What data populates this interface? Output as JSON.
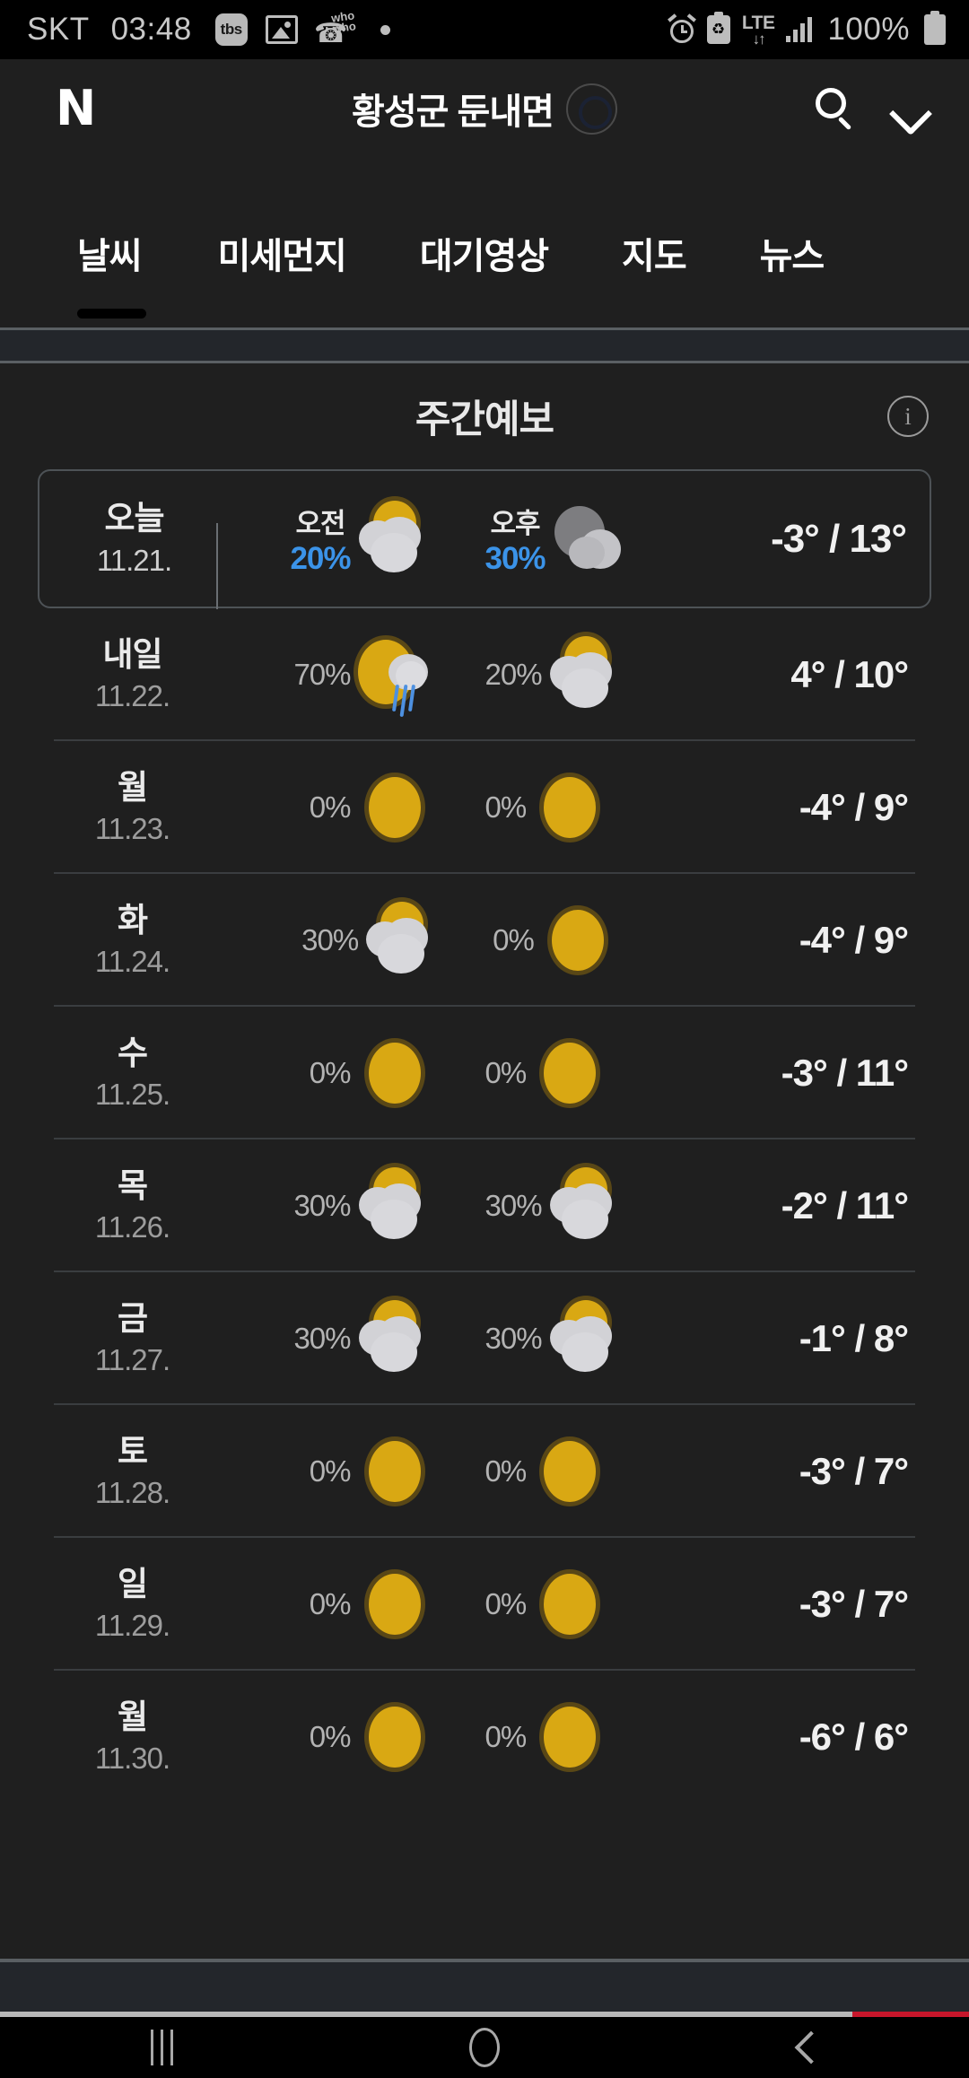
{
  "status_bar": {
    "carrier": "SKT",
    "time": "03:48",
    "app_badge": "tbs",
    "icons": [
      "tbs-badge-icon",
      "gallery-icon",
      "whowho-call-icon",
      "dot-icon",
      "alarm-icon",
      "battery-saver-icon",
      "lte-icon",
      "signal-icon",
      "battery-icon"
    ],
    "lte_label": "LTE",
    "lte_arrows": "↓↑",
    "battery_percent": "100%",
    "whowho_text": "who"
  },
  "header": {
    "logo": "N",
    "location": "황성군 둔내면",
    "search_icon": "search-icon",
    "expand_icon": "chevron-down-icon"
  },
  "tabs": {
    "items": [
      {
        "label": "날씨",
        "active": true
      },
      {
        "label": "미세먼지",
        "active": false
      },
      {
        "label": "대기영상",
        "active": false
      },
      {
        "label": "지도",
        "active": false
      },
      {
        "label": "뉴스",
        "active": false
      }
    ]
  },
  "section": {
    "title": "주간예보",
    "info_icon": "info-icon",
    "info_glyph": "i"
  },
  "forecast": {
    "am_label": "오전",
    "pm_label": "오후",
    "rows": [
      {
        "day": "오늘",
        "date": "11.21.",
        "today": true,
        "am": {
          "pop": "20%",
          "icon": "partly-cloudy-icon",
          "type": "pcloud"
        },
        "pm": {
          "pop": "30%",
          "icon": "cloudy-icon",
          "type": "cloudy"
        },
        "temp": "-3° / 13°"
      },
      {
        "day": "내일",
        "date": "11.22.",
        "today": false,
        "am": {
          "pop": "70%",
          "icon": "rain-icon",
          "type": "rain"
        },
        "pm": {
          "pop": "20%",
          "icon": "partly-cloudy-icon",
          "type": "pcloud"
        },
        "temp": "4° / 10°"
      },
      {
        "day": "월",
        "date": "11.23.",
        "today": false,
        "am": {
          "pop": "0%",
          "icon": "sunny-icon",
          "type": "sunny"
        },
        "pm": {
          "pop": "0%",
          "icon": "sunny-icon",
          "type": "sunny"
        },
        "temp": "-4° / 9°"
      },
      {
        "day": "화",
        "date": "11.24.",
        "today": false,
        "am": {
          "pop": "30%",
          "icon": "partly-cloudy-icon",
          "type": "pcloud"
        },
        "pm": {
          "pop": "0%",
          "icon": "sunny-icon",
          "type": "sunny"
        },
        "temp": "-4° / 9°"
      },
      {
        "day": "수",
        "date": "11.25.",
        "today": false,
        "am": {
          "pop": "0%",
          "icon": "sunny-icon",
          "type": "sunny"
        },
        "pm": {
          "pop": "0%",
          "icon": "sunny-icon",
          "type": "sunny"
        },
        "temp": "-3° / 11°"
      },
      {
        "day": "목",
        "date": "11.26.",
        "today": false,
        "am": {
          "pop": "30%",
          "icon": "partly-cloudy-icon",
          "type": "pcloud"
        },
        "pm": {
          "pop": "30%",
          "icon": "partly-cloudy-icon",
          "type": "pcloud"
        },
        "temp": "-2° / 11°"
      },
      {
        "day": "금",
        "date": "11.27.",
        "today": false,
        "am": {
          "pop": "30%",
          "icon": "partly-cloudy-icon",
          "type": "pcloud"
        },
        "pm": {
          "pop": "30%",
          "icon": "partly-cloudy-icon",
          "type": "pcloud"
        },
        "temp": "-1° / 8°"
      },
      {
        "day": "토",
        "date": "11.28.",
        "today": false,
        "am": {
          "pop": "0%",
          "icon": "sunny-icon",
          "type": "sunny"
        },
        "pm": {
          "pop": "0%",
          "icon": "sunny-icon",
          "type": "sunny"
        },
        "temp": "-3° / 7°"
      },
      {
        "day": "일",
        "date": "11.29.",
        "today": false,
        "am": {
          "pop": "0%",
          "icon": "sunny-icon",
          "type": "sunny"
        },
        "pm": {
          "pop": "0%",
          "icon": "sunny-icon",
          "type": "sunny"
        },
        "temp": "-3° / 7°"
      },
      {
        "day": "월",
        "date": "11.30.",
        "today": false,
        "am": {
          "pop": "0%",
          "icon": "sunny-icon",
          "type": "sunny"
        },
        "pm": {
          "pop": "0%",
          "icon": "sunny-icon",
          "type": "sunny"
        },
        "temp": "-6° / 6°"
      }
    ]
  },
  "nav_bar": {
    "recent_icon": "recents-icon",
    "home_icon": "home-icon",
    "back_icon": "back-icon"
  },
  "colors": {
    "accent_blue": "#3b93e8",
    "sun_yellow": "#d9a813",
    "progress_red": "#c7162b",
    "page_bg": "#1f1f1f"
  }
}
